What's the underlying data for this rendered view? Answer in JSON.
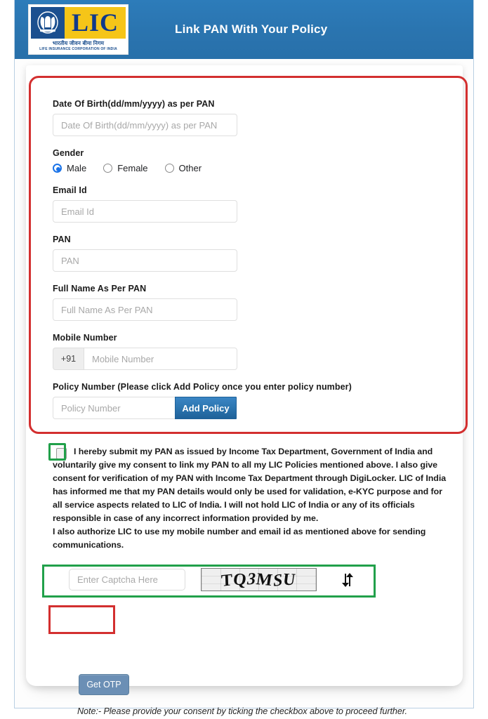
{
  "header": {
    "title": "Link PAN With Your Policy",
    "logo": {
      "mark": "LIC",
      "hindi": "भारतीय जीवन बीमा निगम",
      "english": "LIFE INSURANCE CORPORATION OF INDIA"
    },
    "bg_color": "#2d7cba"
  },
  "form": {
    "dob": {
      "label": "Date Of Birth(dd/mm/yyyy) as per PAN",
      "placeholder": "Date Of Birth(dd/mm/yyyy) as per PAN",
      "value": ""
    },
    "gender": {
      "label": "Gender",
      "selected": "Male",
      "options": [
        "Male",
        "Female",
        "Other"
      ]
    },
    "email": {
      "label": "Email Id",
      "placeholder": "Email Id",
      "value": ""
    },
    "pan": {
      "label": "PAN",
      "placeholder": "PAN",
      "value": ""
    },
    "full_name": {
      "label": "Full Name As Per PAN",
      "placeholder": "Full Name As Per PAN",
      "value": ""
    },
    "mobile": {
      "label": "Mobile Number",
      "country_code": "+91",
      "placeholder": "Mobile Number",
      "value": ""
    },
    "policy": {
      "label": "Policy Number (Please click Add Policy once you enter policy number)",
      "placeholder": "Policy Number",
      "value": "",
      "add_button": "Add Policy",
      "add_button_color": "#2d77b2"
    }
  },
  "consent": {
    "checked": false,
    "paragraph1": "I hereby submit my PAN as issued by Income Tax Department, Government of India and voluntarily give my consent to link my PAN to all my LIC Policies mentioned above. I also give consent for verification of my PAN with Income Tax Department through DigiLocker. LIC of India has informed me that my PAN details would only be used for validation, e-KYC purpose and for all service aspects related to LIC of India. I will not hold LIC of India or any of its officials responsible in case of any incorrect information provided by me.",
    "paragraph2": "I also authorize LIC to use my mobile number and email id as mentioned above for sending communications."
  },
  "captcha": {
    "placeholder": "Enter Captcha Here",
    "value": "",
    "image_text": "TQ3MSU",
    "refresh_icon": "refresh-icon"
  },
  "actions": {
    "get_otp": "Get OTP",
    "get_otp_color": "#6b8fb5",
    "note": "Note:- Please provide your consent by ticking the checkbox above to proceed further."
  },
  "annotations": {
    "red_color": "#d32f2f",
    "green_color": "#21a04a"
  }
}
